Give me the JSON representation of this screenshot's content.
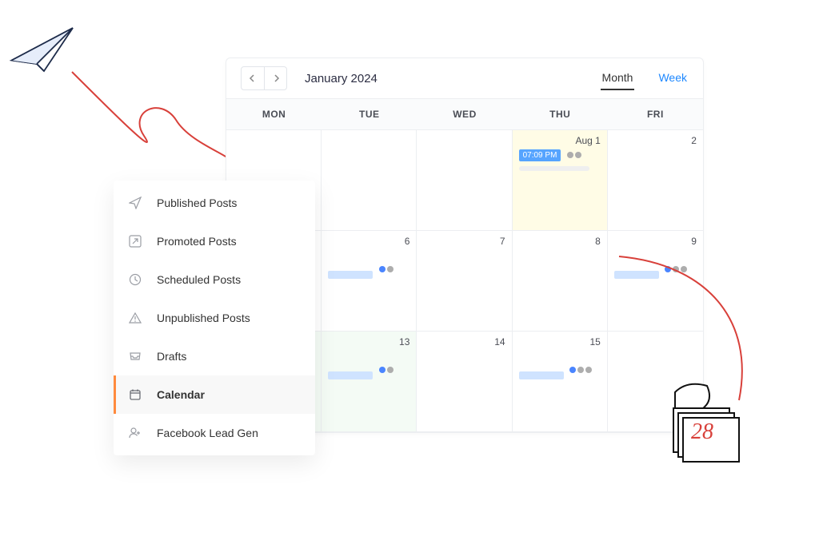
{
  "header": {
    "title": "January 2024",
    "view_month": "Month",
    "view_week": "Week"
  },
  "weekdays": [
    "MON",
    "TUE",
    "WED",
    "THU",
    "FRI"
  ],
  "cells": {
    "r0c3_date": "Aug 1",
    "r0c3_time": "07:09 PM",
    "r0c4_date": "2",
    "r1c1_date": "6",
    "r1c2_date": "7",
    "r1c3_date": "8",
    "r1c4_date": "9",
    "r2c1_date": "13",
    "r2c2_date": "14",
    "r2c3_date": "15"
  },
  "menu": {
    "published": "Published Posts",
    "promoted": "Promoted Posts",
    "scheduled": "Scheduled Posts",
    "unpublished": "Unpublished Posts",
    "drafts": "Drafts",
    "calendar": "Calendar",
    "leadgen": "Facebook Lead Gen"
  },
  "sketch_day": "28"
}
